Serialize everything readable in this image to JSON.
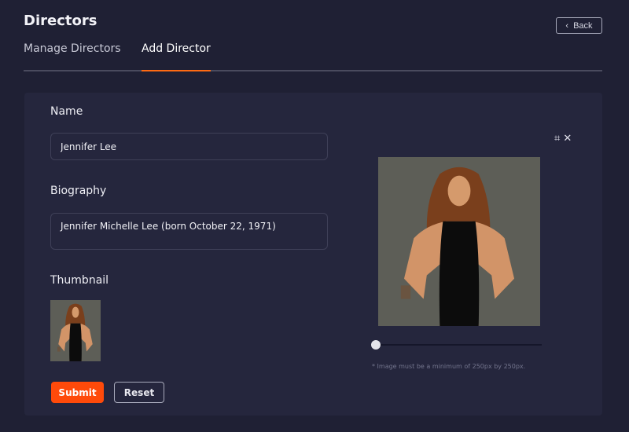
{
  "header": {
    "title": "Directors",
    "back_label": "Back"
  },
  "tabs": [
    {
      "label": "Manage Directors"
    },
    {
      "label": "Add Director",
      "active": true
    }
  ],
  "form": {
    "name_label": "Name",
    "name_value": "Jennifer Lee",
    "bio_label": "Biography",
    "bio_value": "Jennifer Michelle Lee (born October 22, 1971)",
    "thumbnail_label": "Thumbnail",
    "submit_label": "Submit",
    "reset_label": "Reset"
  },
  "cropper": {
    "zoom_fraction": 0,
    "hint": "* Image must be a minimum of 250px by 250px."
  },
  "colors": {
    "accent": "#ff4a0a",
    "tab_underline": "#ff6a13",
    "background": "#1f2034",
    "panel": "#25263d"
  }
}
